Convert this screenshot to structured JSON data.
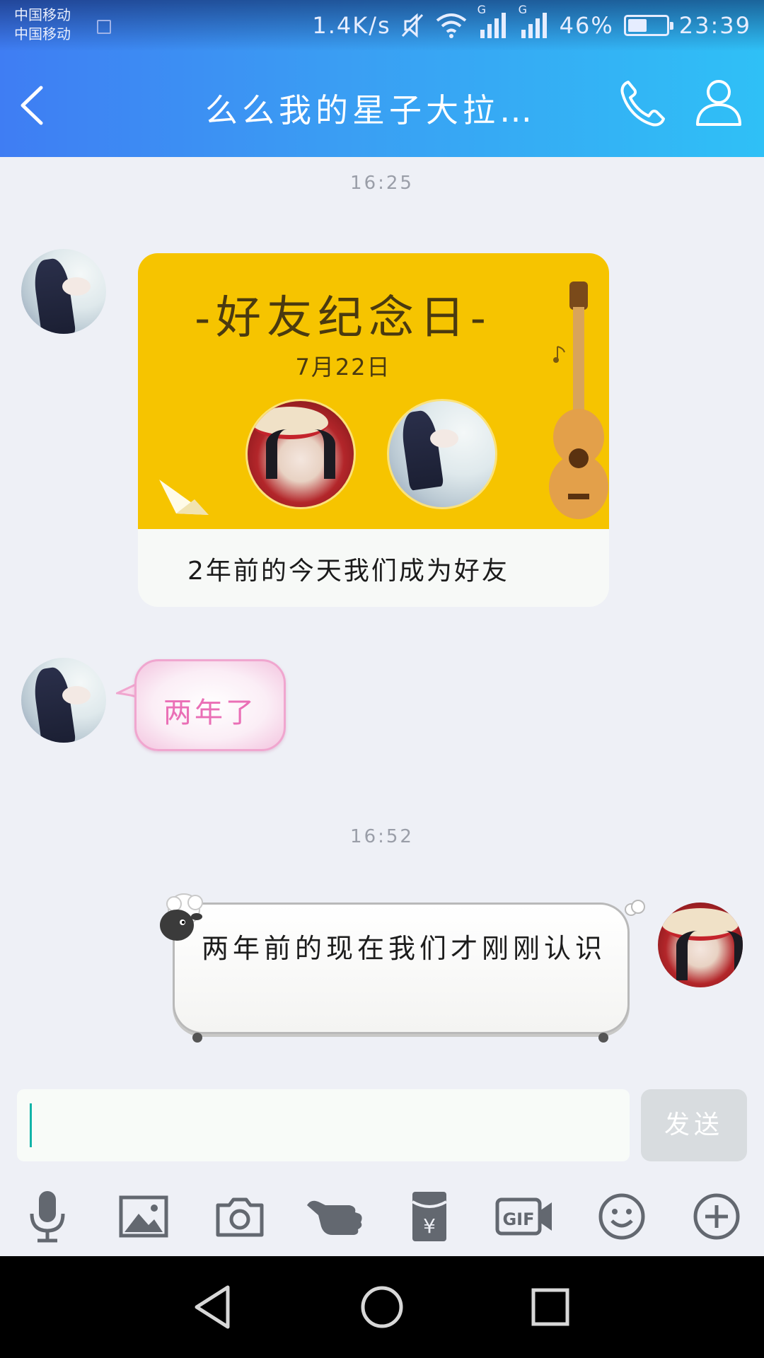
{
  "status_bar": {
    "carrier_1": "中国移动",
    "carrier_2": "中国移动",
    "net_speed": "1.4K/s",
    "signal_label": "G",
    "battery_percent": "46%",
    "battery_level": 0.46,
    "time": "23:39"
  },
  "header": {
    "title": "么么我的星子大拉…",
    "back_icon": "chevron-left-icon",
    "call_icon": "phone-icon",
    "profile_icon": "person-icon"
  },
  "colors": {
    "header_gradient_start": "#3f7df3",
    "header_gradient_end": "#2fc0f6",
    "card_yellow": "#f6c400",
    "pink_text": "#ea6fb6",
    "caret": "#12b3a8"
  },
  "messages": [
    {
      "timestamp": "16:25"
    },
    {
      "type": "anniversary-card",
      "title": "-好友纪念日-",
      "date": "7月22日",
      "caption": "2年前的今天我们成为好友"
    },
    {
      "type": "text",
      "text": "两年了"
    },
    {
      "timestamp": "16:52"
    },
    {
      "type": "text",
      "text": "两年前的现在我们才刚刚认识"
    }
  ],
  "input": {
    "value": "",
    "send_label": "发送"
  },
  "toolbar": [
    {
      "icon": "microphone-icon"
    },
    {
      "icon": "image-icon"
    },
    {
      "icon": "camera-icon"
    },
    {
      "icon": "poke-hand-icon"
    },
    {
      "icon": "red-packet-icon"
    },
    {
      "icon": "gif-icon"
    },
    {
      "icon": "emoji-icon"
    },
    {
      "icon": "plus-icon"
    }
  ],
  "navbar": [
    {
      "icon": "nav-back-icon"
    },
    {
      "icon": "nav-home-icon"
    },
    {
      "icon": "nav-recents-icon"
    }
  ]
}
